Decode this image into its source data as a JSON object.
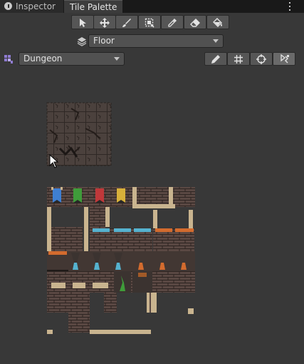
{
  "tabs": [
    {
      "label": "Inspector",
      "icon": "info-icon"
    },
    {
      "label": "Tile Palette"
    }
  ],
  "toolbar": {
    "tools": [
      "select-tool",
      "move-tool",
      "brush-tool",
      "box-fill-tool",
      "picker-tool",
      "eraser-tool",
      "fill-tool"
    ]
  },
  "active_tilemap": {
    "value": "Floor",
    "icon": "layer-icon"
  },
  "palette_select": {
    "value": "Dungeon",
    "icon": "palette-icon"
  },
  "edit_tools": [
    "edit-palette-icon",
    "grid-icon",
    "gizmo-icon",
    "focus-icon"
  ],
  "colors": {
    "panel": "#383838",
    "tab_strip": "#191919",
    "stone": "#4a403c",
    "brick": "#5c4a44",
    "sand": "#c9b48f",
    "banner_blue": "#3f7fd2",
    "banner_green": "#3f9c3a",
    "banner_red": "#c0383a",
    "banner_yellow": "#d8b03a",
    "water": "#55b2cf",
    "lava": "#d36b2e"
  }
}
